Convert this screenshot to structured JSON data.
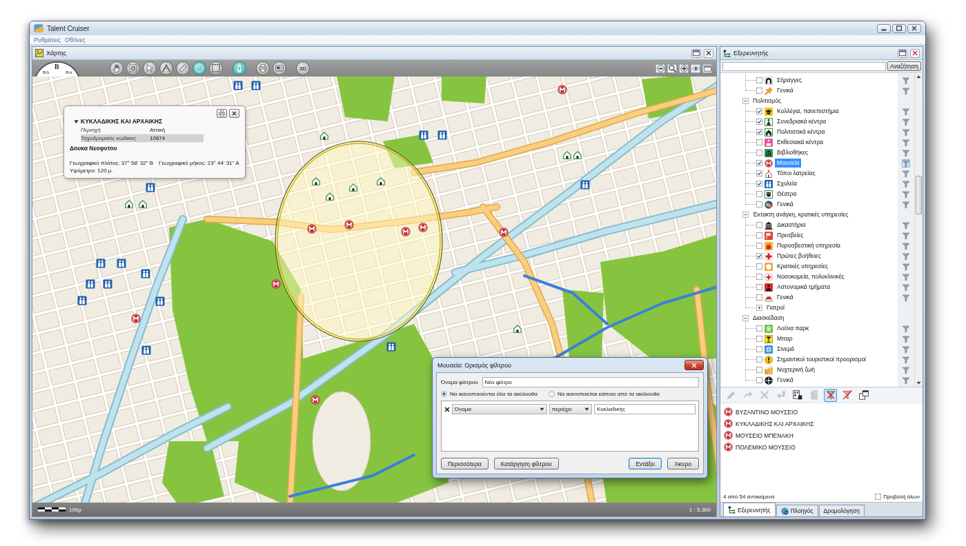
{
  "window": {
    "title": "Talent Cruiser"
  },
  "menu": [
    "Ρυθμίσεις",
    "Οθόνες"
  ],
  "map_panel": {
    "title": "Χάρτης",
    "compass": [
      "ΒΔ",
      "Β",
      "ΒΑ"
    ],
    "tools": [
      {
        "selected": false
      },
      {
        "selected": false
      },
      {
        "selected": false
      },
      {
        "selected": false
      },
      {
        "selected": false
      },
      {
        "selected": true
      },
      {
        "selected": false
      },
      {
        "selected": true
      },
      {
        "selected": false
      },
      {
        "selected": false
      },
      {
        "label": "3D",
        "selected": false
      }
    ],
    "info_popup": {
      "title": "ΚΥΚΛΑΔΙΚΗΣ ΚΑΙ ΑΡΧΑΙΚΗΣ",
      "expanded": true,
      "fields": [
        {
          "label": "Περιοχή",
          "value": "Αττική",
          "selected": false
        },
        {
          "label": "Ταχυδρομικός κώδικας",
          "value": "10674",
          "selected": true
        }
      ],
      "address": "Δουκα Νεοφυτου",
      "latitude": "Γεωγραφικό πλάτος: 37° 58' 32\" Β",
      "longitude": "Γεωγραφικό μήκος: 23° 44' 31\" Α",
      "altitude": "Υψόμετρο: 120 μ."
    },
    "status_bar": {
      "scale": "100μ",
      "ratio": "1 : 5.300"
    }
  },
  "explorer": {
    "title": "Εξερευνητής",
    "search_button": "Αναζήτηση",
    "tree": [
      {
        "children": [
          {
            "label": "Σήραγγες",
            "checked": false,
            "selected": false,
            "filtered": false
          },
          {
            "label": "Γενικά",
            "checked": false,
            "selected": false,
            "filtered": false
          }
        ]
      },
      {
        "label": "Πολιτισμός",
        "expanded": true,
        "children": [
          {
            "label": "Κολλέγια, πανεπιστήμια",
            "checked": true,
            "selected": false,
            "filtered": false
          },
          {
            "label": "Συνεδριακά κέντρα",
            "checked": true,
            "selected": false,
            "filtered": false
          },
          {
            "label": "Πολιτιστικά κέντρα",
            "checked": true,
            "selected": false,
            "filtered": false
          },
          {
            "label": "Εκθεσιακά κέντρα",
            "checked": false,
            "selected": false,
            "filtered": false
          },
          {
            "label": "Βιβλιοθήκες",
            "checked": false,
            "selected": false,
            "filtered": false
          },
          {
            "label": "Μουσεία",
            "checked": true,
            "selected": true,
            "filtered": true
          },
          {
            "label": "Τόποι λατρείας",
            "checked": true,
            "selected": false,
            "filtered": false
          },
          {
            "label": "Σχολεία",
            "checked": true,
            "selected": false,
            "filtered": false
          },
          {
            "label": "Θέατρα",
            "checked": false,
            "selected": false,
            "filtered": false
          },
          {
            "label": "Γενικά",
            "checked": false,
            "selected": false,
            "filtered": false
          }
        ]
      },
      {
        "label": "Έκτακτη ανάγκη, κρατικές υπηρεσίες",
        "expanded": true,
        "children": [
          {
            "label": "Δικαστήρια",
            "checked": false,
            "selected": false,
            "filtered": false
          },
          {
            "label": "Πρεσβείες",
            "checked": false,
            "selected": false,
            "filtered": false
          },
          {
            "label": "Πυροσβεστική υπηρεσία",
            "checked": false,
            "selected": false,
            "filtered": false
          },
          {
            "label": "Πρώτες βοήθειες",
            "checked": true,
            "selected": false,
            "filtered": false
          },
          {
            "label": "Κρατικές υπηρεσίες",
            "checked": false,
            "selected": false,
            "filtered": false
          },
          {
            "label": "Νοσοκομεία, πολυκλινικές",
            "checked": false,
            "selected": false,
            "filtered": false
          },
          {
            "label": "Αστυνομικά τμήματα",
            "checked": false,
            "selected": false,
            "filtered": false
          },
          {
            "label": "Γενικά",
            "checked": false,
            "selected": false,
            "filtered": false
          },
          {
            "label": "Γιατροί",
            "expanded": false
          }
        ]
      },
      {
        "label": "Διασκέδαση",
        "expanded": true,
        "children": [
          {
            "label": "Λούνα παρκ",
            "checked": false,
            "selected": false,
            "filtered": false
          },
          {
            "label": "Μπαρ",
            "checked": false,
            "selected": false,
            "filtered": false
          },
          {
            "label": "Σινεμά",
            "checked": false,
            "selected": false,
            "filtered": false
          },
          {
            "label": "Σημαντικοί τουριστικοί προορισμοί",
            "checked": false,
            "selected": false,
            "filtered": false
          },
          {
            "label": "Νυχτερινή ζωή",
            "checked": false,
            "selected": false,
            "filtered": false
          },
          {
            "label": "Γενικά",
            "checked": false,
            "selected": false,
            "filtered": false
          }
        ]
      }
    ],
    "toolbar": [
      {
        "disabled": true,
        "selected": false
      },
      {
        "disabled": true,
        "selected": false
      },
      {
        "disabled": true,
        "selected": false
      },
      {
        "disabled": true,
        "selected": false
      },
      {
        "disabled": false,
        "selected": false
      },
      {
        "disabled": true,
        "selected": false
      },
      {
        "disabled": false,
        "selected": true
      },
      {
        "disabled": false,
        "selected": false
      },
      {
        "disabled": false,
        "selected": false
      }
    ],
    "results": [
      "ΒΥΖΑΝΤΙΝΟ ΜΟΥΣΕΙΟ",
      "ΚΥΚΛΑΔΙΚΗΣ ΚΑΙ ΑΡΧΑΙΚΗΣ",
      "ΜΟΥΣΕΙΟ ΜΠΕΝΑΚΗ",
      "ΠΟΛΕΜΙΚΟ ΜΟΥΣΕΙΟ"
    ],
    "count": "4 από 54 αντικείμενα",
    "show_all": {
      "label": "Προβολή όλων",
      "checked": false
    },
    "tabs": [
      {
        "label": "Εξερευνητής",
        "selected": true
      },
      {
        "label": "Πλοηγός",
        "selected": false
      },
      {
        "label": "Δρομολόγηση",
        "selected": false
      }
    ]
  },
  "filter_dialog": {
    "title": "Μουσεία: Ορισμός φίλτρου",
    "name_label": "Όνομα φίλτρου",
    "name_value": "Νέο φίλτρο",
    "match_options": [
      {
        "label": "Να ικανοποιούνται όλα τα ακόλουθα",
        "selected": true
      },
      {
        "label": "Να ικανοποιείται κάποιο από τα ακόλουθα",
        "selected": false
      }
    ],
    "conditions": [
      {
        "field": "Όνομα",
        "operator": "περιέχει",
        "value": "Κυκλαδικής"
      }
    ],
    "buttons": [
      {
        "label": "Περισσότερα",
        "default": false
      },
      {
        "label": "Κατάργηση φίλτρου",
        "default": false
      },
      {
        "label": "Εντάξει",
        "default": true
      },
      {
        "label": "Άκυρο",
        "default": false
      }
    ]
  }
}
